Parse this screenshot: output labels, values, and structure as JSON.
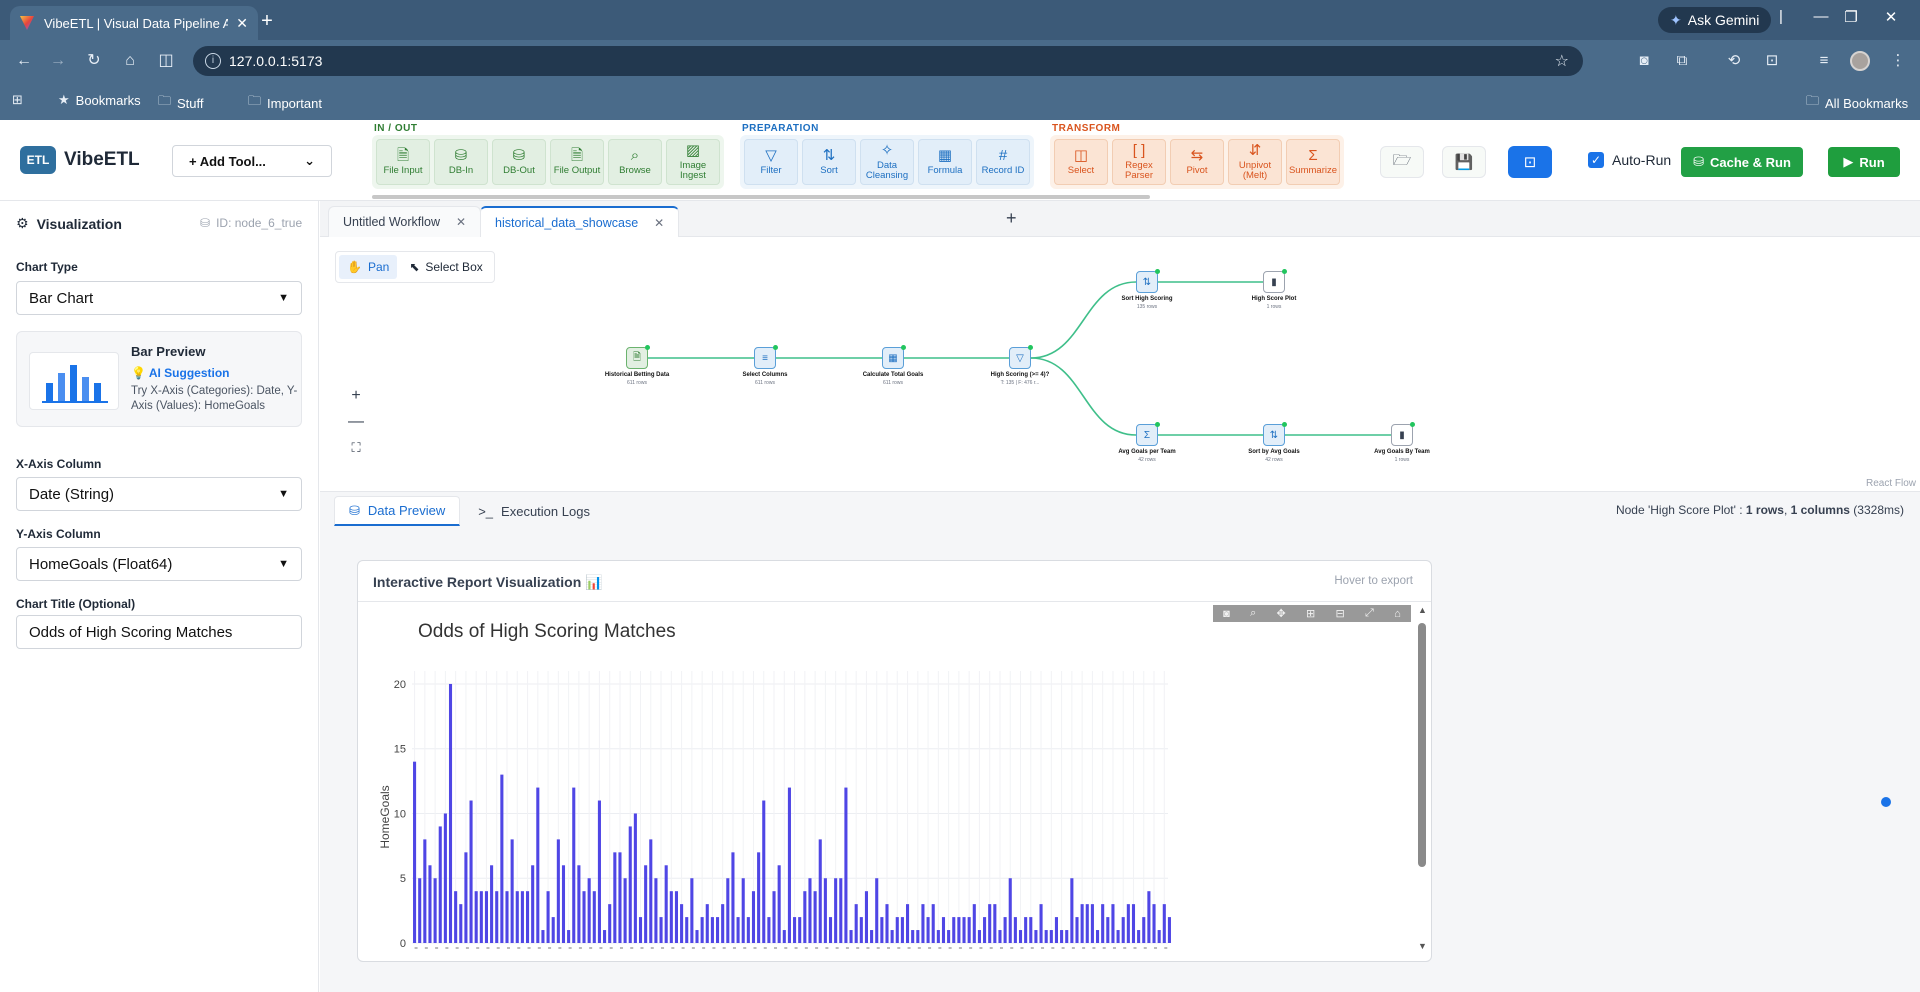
{
  "browser": {
    "tab_title": "VibeETL | Visual Data Pipeline A",
    "url": "127.0.0.1:5173",
    "ask_gemini": "Ask Gemini",
    "bookmarks": [
      "Bookmarks",
      "Stuff",
      "Important"
    ],
    "all_bookmarks": "All Bookmarks"
  },
  "app": {
    "logo_badge": "ETL",
    "logo_name": "VibeETL",
    "add_tool": "+ Add Tool...",
    "groups": [
      {
        "label": "IN / OUT",
        "color": "#2f7d32",
        "tools": [
          {
            "label": "File Input",
            "icon": "file-icon"
          },
          {
            "label": "DB-In",
            "icon": "database-icon"
          },
          {
            "label": "DB-Out",
            "icon": "database-icon"
          },
          {
            "label": "File Output",
            "icon": "file-icon"
          },
          {
            "label": "Browse",
            "icon": "search-icon"
          },
          {
            "label": "Image Ingest",
            "icon": "image-icon"
          }
        ]
      },
      {
        "label": "PREPARATION",
        "color": "#1d6fc1",
        "tools": [
          {
            "label": "Filter",
            "icon": "filter-icon"
          },
          {
            "label": "Sort",
            "icon": "sort-icon"
          },
          {
            "label": "Data Cleansing",
            "icon": "sparkle-icon"
          },
          {
            "label": "Formula",
            "icon": "calculator-icon"
          },
          {
            "label": "Record ID",
            "icon": "hash-icon"
          }
        ]
      },
      {
        "label": "TRANSFORM",
        "color": "#d9541e",
        "tools": [
          {
            "label": "Select",
            "icon": "columns-icon"
          },
          {
            "label": "Regex Parser",
            "icon": "brackets-icon"
          },
          {
            "label": "Pivot",
            "icon": "swap-icon"
          },
          {
            "label": "Unpivot (Melt)",
            "icon": "updown-icon"
          },
          {
            "label": "Summarize",
            "icon": "sigma-icon"
          }
        ]
      }
    ],
    "auto_run": "Auto-Run",
    "cache_run": "Cache & Run",
    "run": "Run"
  },
  "left_panel": {
    "title": "Visualization",
    "node_id": "ID: node_6_true",
    "chart_type_label": "Chart Type",
    "chart_type_value": "Bar Chart",
    "preview_title": "Bar Preview",
    "ai_label": "AI Suggestion",
    "ai_hint": "Try X-Axis (Categories): Date, Y-Axis (Values): HomeGoals",
    "x_label": "X-Axis Column",
    "x_value": "Date (String)",
    "y_label": "Y-Axis Column",
    "y_value": "HomeGoals (Float64)",
    "title_label": "Chart Title (Optional)",
    "title_value": "Odds of High Scoring Matches"
  },
  "editor_tabs": [
    {
      "label": "Untitled Workflow",
      "active": false
    },
    {
      "label": "historical_data_showcase",
      "active": true
    }
  ],
  "canvas": {
    "pan": "Pan",
    "select_box": "Select Box",
    "credit": "React Flow",
    "nodes": [
      {
        "label": "Historical Betting Data",
        "sub": "611 rows",
        "kind": "io"
      },
      {
        "label": "Select Columns",
        "sub": "611 rows",
        "kind": "prep"
      },
      {
        "label": "Calculate Total Goals",
        "sub": "611 rows",
        "kind": "prep"
      },
      {
        "label": "High Scoring (>= 4)?",
        "sub": "T: 135 | F: 476 r...",
        "kind": "prep"
      },
      {
        "label": "Sort High Scoring",
        "sub": "135 rows",
        "kind": "prep"
      },
      {
        "label": "High Score Plot",
        "sub": "1 rows",
        "kind": "out"
      },
      {
        "label": "Avg Goals per Team",
        "sub": "42 rows",
        "kind": "prep"
      },
      {
        "label": "Sort by Avg Goals",
        "sub": "42 rows",
        "kind": "prep"
      },
      {
        "label": "Avg Goals By Team",
        "sub": "1 rows",
        "kind": "out"
      }
    ]
  },
  "bottom": {
    "tab_preview": "Data Preview",
    "tab_logs": "Execution Logs",
    "status_prefix": "Node 'High Score Plot' : ",
    "status_rows": "1 rows",
    "status_cols": "1 columns",
    "status_suffix": " (3328ms)",
    "report_title": "Interactive Report Visualization 📊",
    "report_hint": "Hover to export"
  },
  "chart_data": {
    "type": "bar",
    "title": "Odds of High Scoring Matches",
    "ylabel": "HomeGoals",
    "ylim": [
      0,
      21
    ],
    "yticks": [
      0,
      5,
      10,
      15,
      20
    ],
    "color": "#4f46e5",
    "grid": true,
    "values": [
      14,
      5,
      8,
      6,
      5,
      9,
      10,
      20,
      4,
      3,
      7,
      11,
      4,
      4,
      4,
      6,
      4,
      13,
      4,
      8,
      4,
      4,
      4,
      6,
      12,
      1,
      4,
      2,
      8,
      6,
      1,
      12,
      6,
      4,
      5,
      4,
      11,
      1,
      3,
      7,
      7,
      5,
      9,
      10,
      2,
      6,
      8,
      5,
      2,
      6,
      4,
      4,
      3,
      2,
      5,
      1,
      2,
      3,
      2,
      2,
      3,
      5,
      7,
      2,
      5,
      2,
      4,
      7,
      11,
      2,
      4,
      6,
      1,
      12,
      2,
      2,
      4,
      5,
      4,
      8,
      5,
      2,
      5,
      5,
      12,
      1,
      3,
      2,
      4,
      1,
      5,
      2,
      3,
      1,
      2,
      2,
      3,
      1,
      1,
      3,
      2,
      3,
      1,
      2,
      1,
      2,
      2,
      2,
      2,
      3,
      1,
      2,
      3,
      3,
      1,
      2,
      5,
      2,
      1,
      2,
      2,
      1,
      3,
      1,
      1,
      2,
      1,
      1,
      5,
      2,
      3,
      3,
      3,
      1,
      3,
      2,
      3,
      1,
      2,
      3,
      3,
      1,
      2,
      4,
      3,
      1,
      3,
      2
    ]
  }
}
